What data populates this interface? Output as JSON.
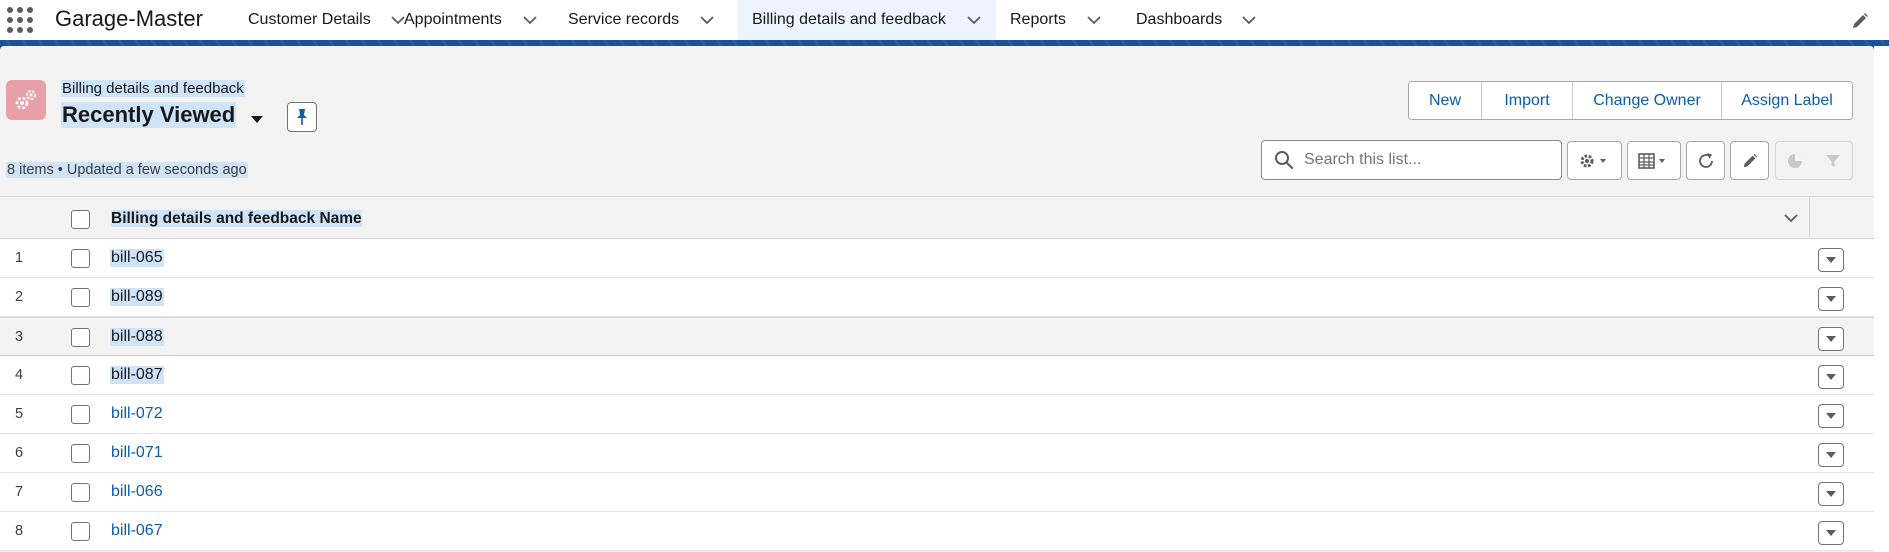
{
  "app": {
    "name": "Garage-Master"
  },
  "nav": {
    "items": [
      {
        "label": "Customer Details",
        "active": false
      },
      {
        "label": "Appointments",
        "active": false
      },
      {
        "label": "Service records",
        "active": false
      },
      {
        "label": "Billing details and feedback",
        "active": true
      },
      {
        "label": "Reports",
        "active": false
      },
      {
        "label": "Dashboards",
        "active": false
      }
    ],
    "edit_icon": "pencil-icon"
  },
  "header": {
    "object_label": "Billing details and feedback",
    "list_view": "Recently Viewed",
    "status": "8 items • Updated a few seconds ago",
    "object_icon": "gears-icon",
    "object_icon_color": "#e8a0a8"
  },
  "actions": {
    "new": "New",
    "import": "Import",
    "change_owner": "Change Owner",
    "assign_label": "Assign Label"
  },
  "search": {
    "placeholder": "Search this list...",
    "value": ""
  },
  "toolbar": {
    "settings_icon": "gear-icon",
    "display_icon": "table-icon",
    "refresh_icon": "refresh-icon",
    "edit_icon": "pencil-icon",
    "chart_icon": "pie-chart-icon",
    "filter_icon": "filter-icon"
  },
  "table": {
    "column_header": "Billing details and feedback Name",
    "rows": [
      {
        "num": "1",
        "name": "bill-065",
        "link": false
      },
      {
        "num": "2",
        "name": "bill-089",
        "link": false
      },
      {
        "num": "3",
        "name": "bill-088",
        "link": false
      },
      {
        "num": "4",
        "name": "bill-087",
        "link": false
      },
      {
        "num": "5",
        "name": "bill-072",
        "link": true
      },
      {
        "num": "6",
        "name": "bill-071",
        "link": true
      },
      {
        "num": "7",
        "name": "bill-066",
        "link": true
      },
      {
        "num": "8",
        "name": "bill-067",
        "link": true
      }
    ]
  },
  "colors": {
    "brand_band": "#1b5297",
    "link": "#0b5cab",
    "selection_highlight": "#cfe3f9",
    "active_tab": "#eef4ff"
  }
}
